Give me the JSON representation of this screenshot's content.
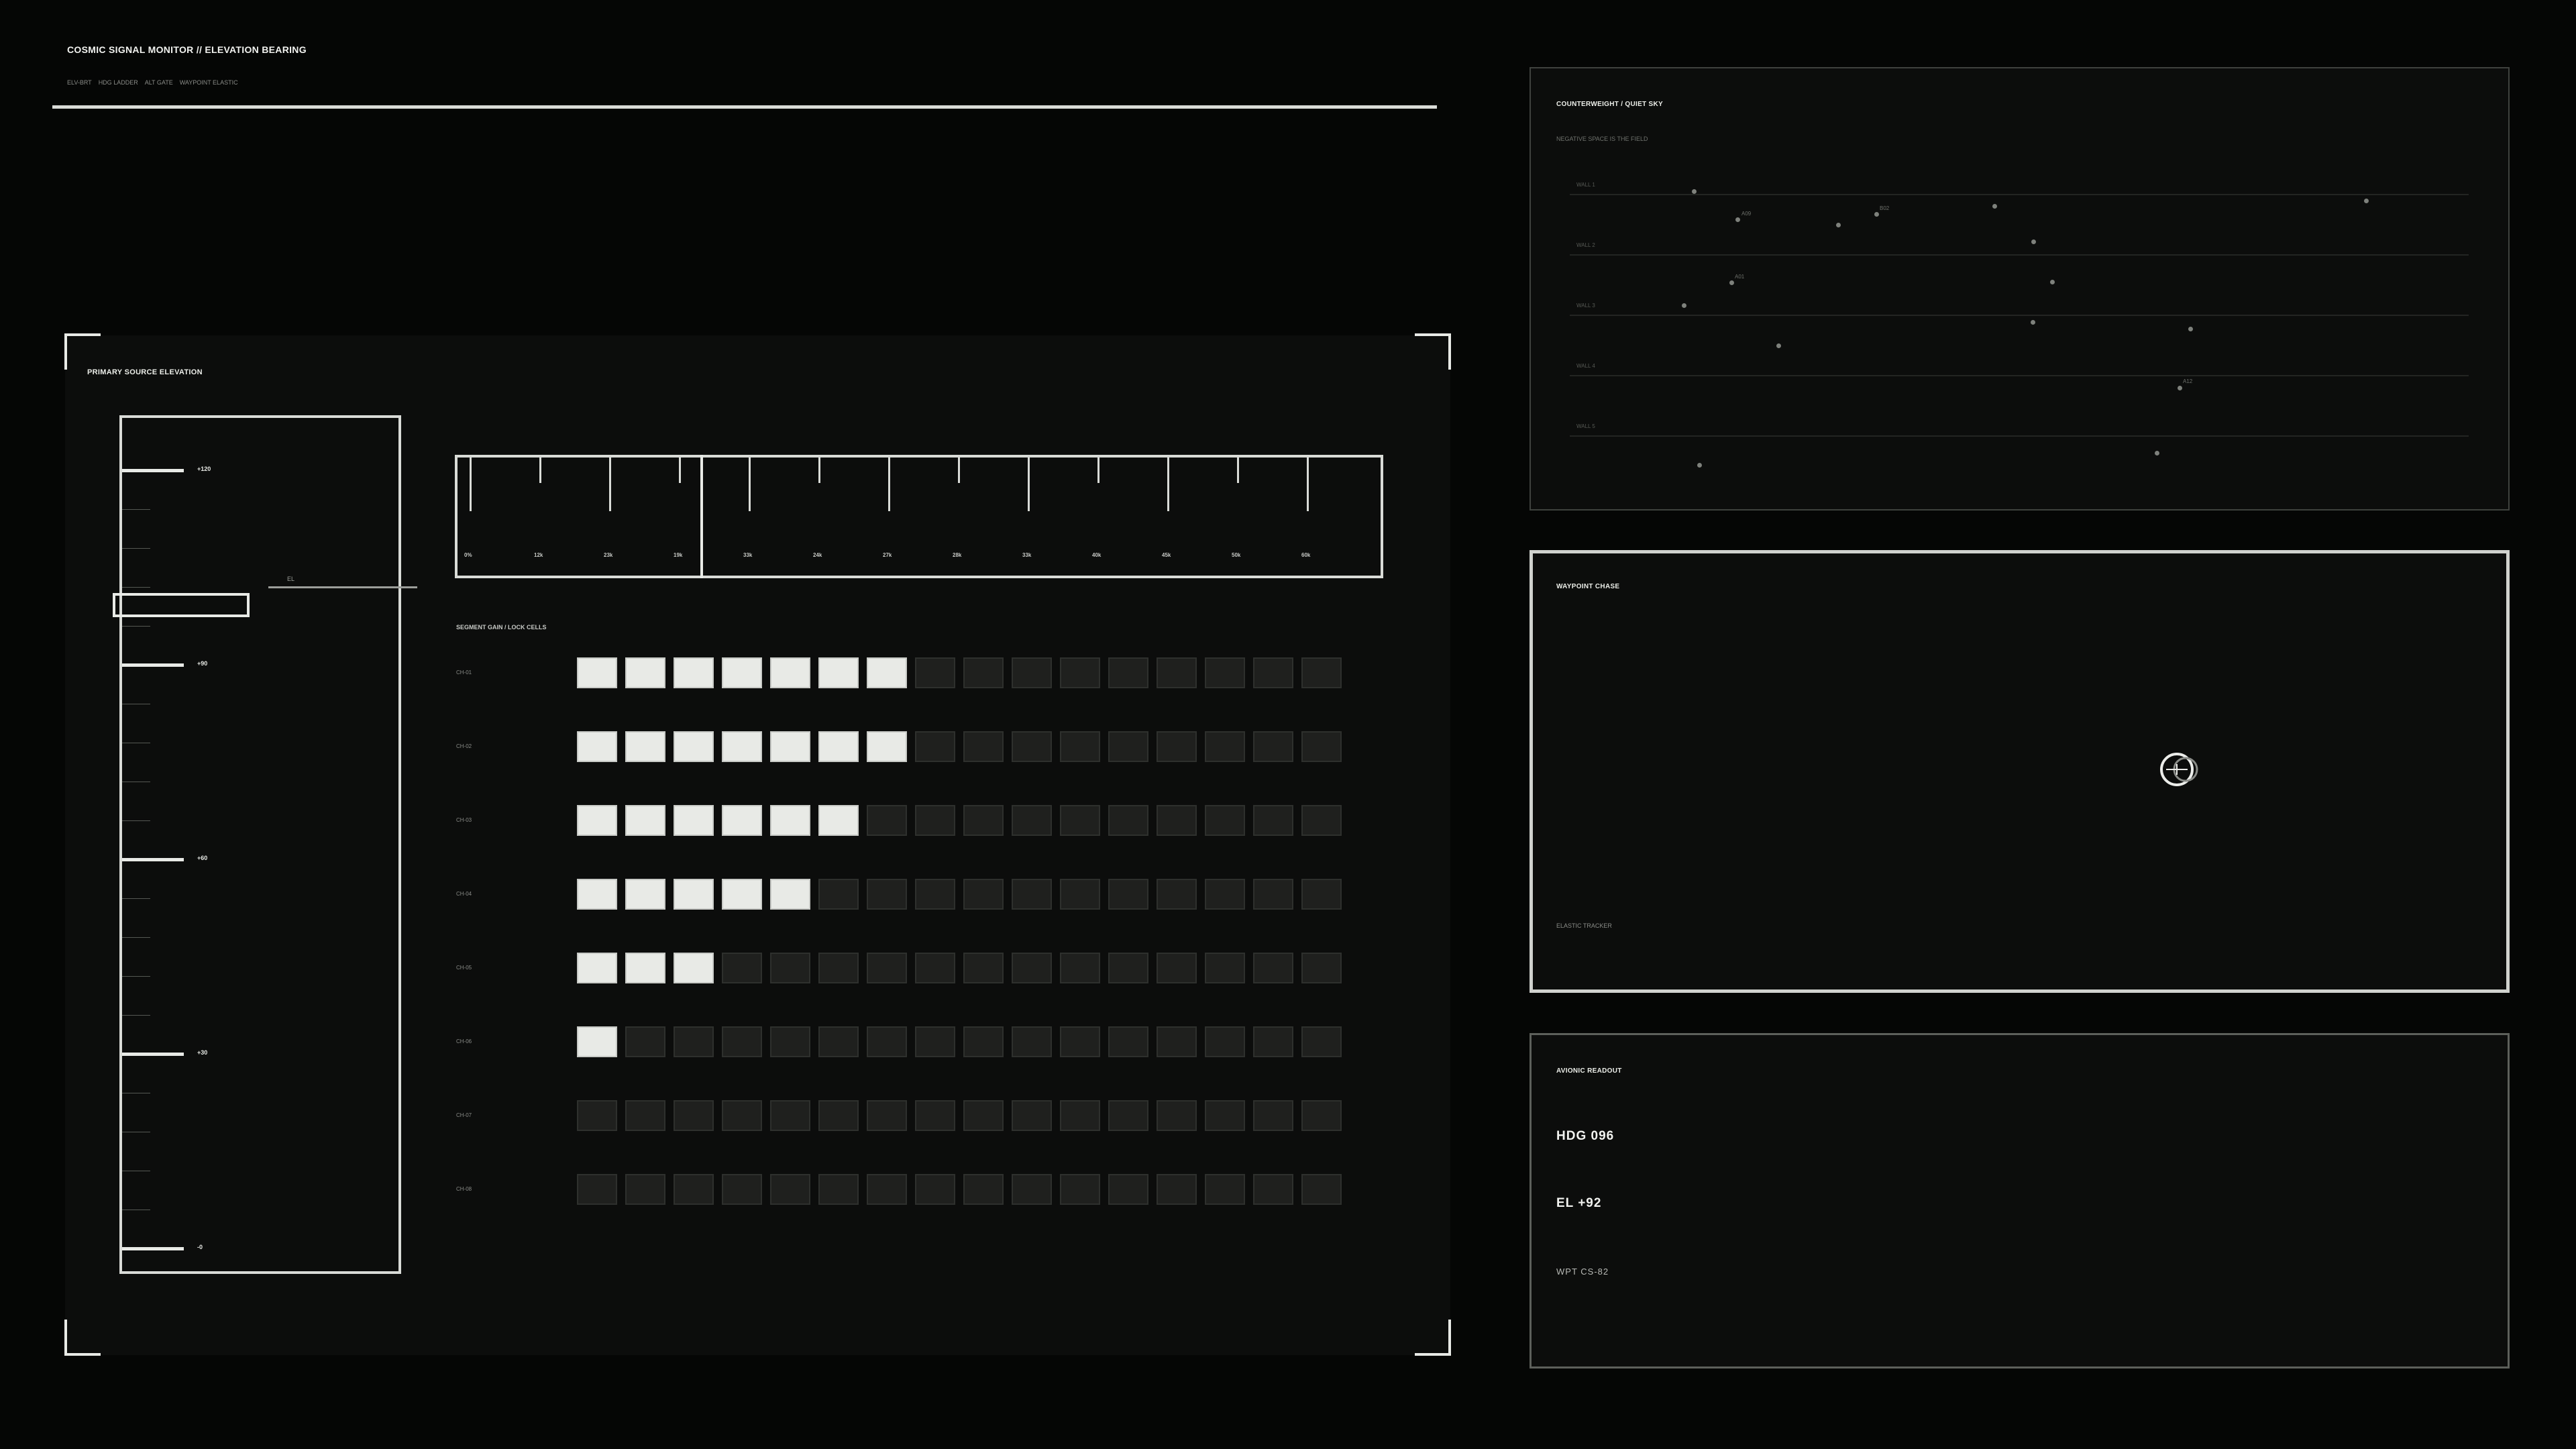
{
  "header": {
    "title": "COSMIC SIGNAL MONITOR // ELEVATION BEARING",
    "subnav": [
      "ELV-BRT",
      "HDG LADDER",
      "ALT GATE",
      "WAYPOINT ELASTIC"
    ]
  },
  "main_panel": {
    "title": "PRIMARY  SOURCE ELEVATION",
    "ladder_labels": [
      "+120",
      "+90",
      "+60",
      "+30",
      "-0"
    ],
    "cursor_label": "EL",
    "heading_ticks": [
      "0%",
      "12k",
      "23k",
      "19k",
      "33k",
      "24k",
      "27k",
      "28k",
      "33k",
      "40k",
      "45k",
      "50k",
      "60k"
    ],
    "grid": {
      "title": "SEGMENT GAIN / LOCK CELLS",
      "rows": [
        {
          "label": "CH-01",
          "lit": 7
        },
        {
          "label": "CH-02",
          "lit": 7
        },
        {
          "label": "CH-03",
          "lit": 6
        },
        {
          "label": "CH-04",
          "lit": 5
        },
        {
          "label": "CH-05",
          "lit": 3
        },
        {
          "label": "CH-06",
          "lit": 1
        },
        {
          "label": "CH-07",
          "lit": 0
        },
        {
          "label": "CH-08",
          "lit": 0
        }
      ],
      "columns": 16
    }
  },
  "sky_panel": {
    "title": "COUNTERWEIGHT  /  QUIET SKY",
    "subtitle": "NEGATIVE SPACE IS THE FIELD",
    "bands": [
      "WALL 1",
      "WALL 2",
      "WALL 3",
      "WALL 4",
      "WALL 5"
    ],
    "tags": [
      "A09",
      "B02",
      "A01",
      "A12"
    ]
  },
  "waypoint_panel": {
    "title": "WAYPOINT CHASE",
    "footer": "ELASTIC TRACKER"
  },
  "readout_panel": {
    "title": "AVIONIC READOUT",
    "heading": "HDG  096",
    "elevation": "EL  +92",
    "waypoint": "WPT  CS-82"
  }
}
